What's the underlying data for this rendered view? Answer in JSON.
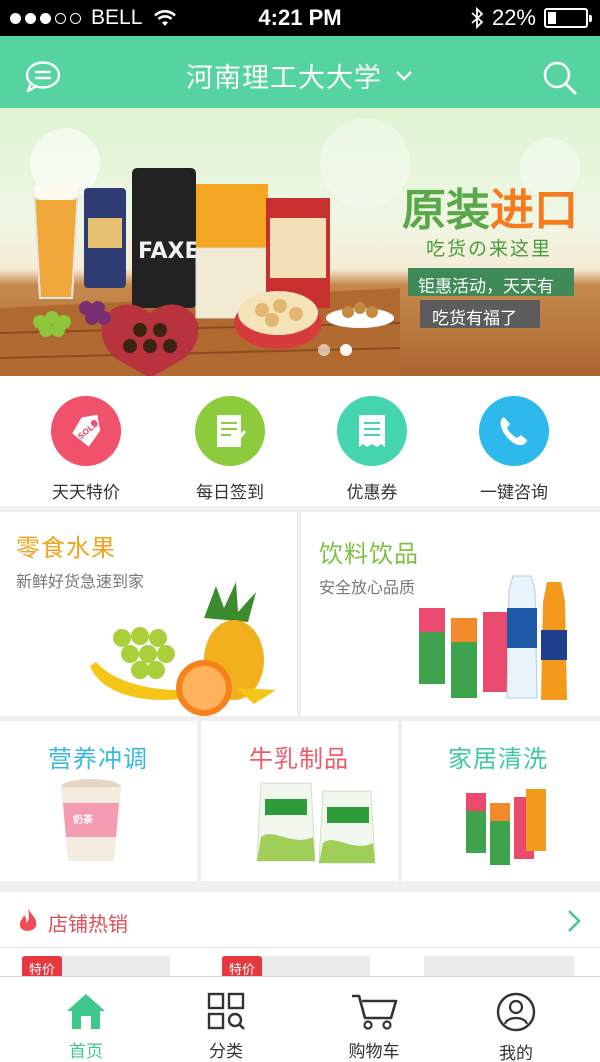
{
  "status_bar": {
    "carrier": "BELL",
    "time": "4:21 PM",
    "battery": "22%",
    "battery_level": 0.22
  },
  "header": {
    "title": "河南理工大大学"
  },
  "banner": {
    "headline_main": "原装",
    "headline_accent": "进口",
    "subline": "吃货の来这里",
    "tag1": "钜惠活动，天天有",
    "tag2": "吃货有福了",
    "pager_count": 2,
    "pager_active": 1
  },
  "quick_actions": [
    {
      "label": "天天特价",
      "icon": "sold-tag-icon",
      "color": "#f0516b"
    },
    {
      "label": "每日签到",
      "icon": "checklist-icon",
      "color": "#8ccc3c"
    },
    {
      "label": "优惠券",
      "icon": "coupon-icon",
      "color": "#45d4b0"
    },
    {
      "label": "一键咨询",
      "icon": "phone-icon",
      "color": "#2db9ec"
    }
  ],
  "categories": {
    "snacks": {
      "title": "零食水果",
      "subtitle": "新鲜好货急速到家",
      "color": "#f3a21e"
    },
    "drinks": {
      "title": "饮料饮品",
      "subtitle": "安全放心品质",
      "color": "#7cc141"
    },
    "nutrition": {
      "title": "营养冲调",
      "color": "#37b8e3"
    },
    "dairy": {
      "title": "牛乳制品",
      "color": "#ec5a6a"
    },
    "cleaning": {
      "title": "家居清洗",
      "color": "#3ec9a0"
    }
  },
  "hot": {
    "label": "店铺热销",
    "badge": "特价"
  },
  "tabbar": [
    {
      "label": "首页",
      "active": true
    },
    {
      "label": "分类",
      "active": false
    },
    {
      "label": "购物车",
      "active": false
    },
    {
      "label": "我的",
      "active": false
    }
  ],
  "colors": {
    "brand": "#55d3a0",
    "active_tab": "#3fc88c"
  }
}
